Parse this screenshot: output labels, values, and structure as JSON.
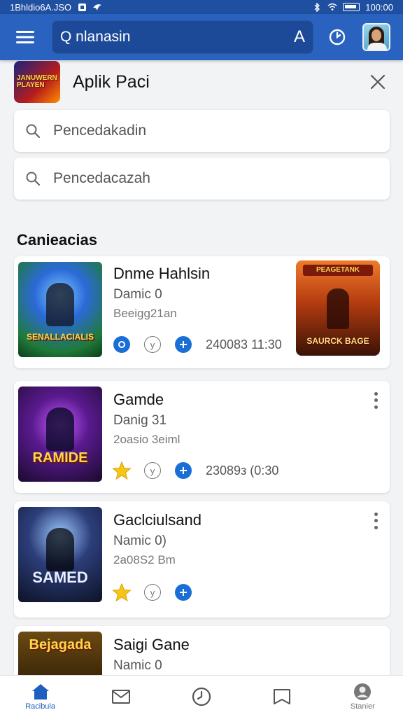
{
  "status_bar": {
    "left_text": "1Bhldio6A.JSO",
    "time": "100:00"
  },
  "app_bar": {
    "search_text": "Q nlanasin",
    "search_letter": "A"
  },
  "app_header": {
    "title": "Aplik Paci",
    "thumb_text": "JANUWERN PLAYEN"
  },
  "search_fields": [
    {
      "placeholder": "Pencedakadin"
    },
    {
      "placeholder": "Pencedacazah"
    }
  ],
  "section": {
    "title": "Canieacias"
  },
  "cards": [
    {
      "title": "Dnme Hahlsin",
      "sub1": "Damic 0",
      "sub2": "Beeigg21an",
      "meta": "240083  11:30",
      "thumb_text": "SENALLACIALIS",
      "side_thumb_banner": "PEAGETANK",
      "side_thumb_text": "SAURCK BAGE"
    },
    {
      "title": "Gamde",
      "sub1": "Danig 31",
      "sub2": "2oasio 3eiml",
      "meta": "23089з  (0:30",
      "thumb_text": "RAMIDE"
    },
    {
      "title": "Gaclciulsand",
      "sub1": "Namic 0)",
      "sub2": "2a08S2 Bm",
      "thumb_text": "SAMED"
    },
    {
      "title": "Saigi Gane",
      "sub1": "Namic 0",
      "thumb_text": "Bejagada"
    }
  ],
  "bottom_nav": [
    {
      "label": "Racibula",
      "icon": "home-icon",
      "active": true
    },
    {
      "label": "",
      "icon": "mail-icon"
    },
    {
      "label": "",
      "icon": "clock-icon"
    },
    {
      "label": "",
      "icon": "book-icon"
    },
    {
      "label": "Stanier",
      "icon": "profile-icon"
    }
  ],
  "colors": {
    "app_bar": "#2a62bf",
    "accent_blue": "#1a6fd6",
    "star": "#f5c518"
  }
}
